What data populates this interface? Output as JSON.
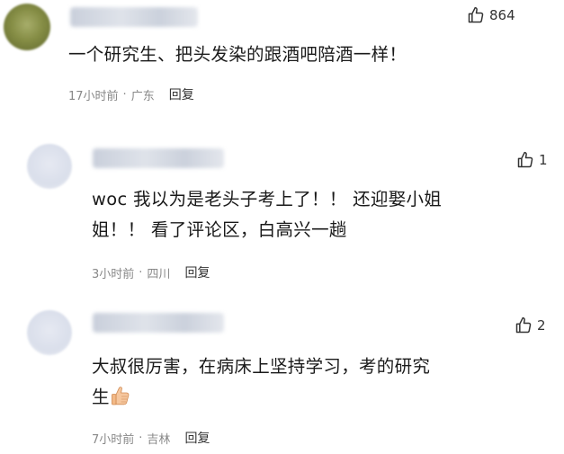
{
  "comments": [
    {
      "likes": "864",
      "text": [
        "一个研究生、把头发染的跟酒吧陪酒一样！"
      ],
      "time": "17小时前",
      "location": "广东",
      "reply": "回复"
    },
    {
      "likes": "1",
      "text": [
        "woc 我以为是老头子考上了！！ 还迎娶小姐",
        "姐！！ 看了评论区，白高兴一趟"
      ],
      "time": "3小时前",
      "location": "四川",
      "reply": "回复"
    },
    {
      "likes": "2",
      "text": [
        "大叔很厉害，在病床上坚持学习，考的研究",
        "生"
      ],
      "emoji": "thumbs-up",
      "time": "7小时前",
      "location": "吉林",
      "reply": "回复"
    }
  ],
  "meta_separator": "·",
  "colors": {
    "avatar_1": "#7f8a3e",
    "avatar_reply": "#dde2ee",
    "username_blur": "#cfd4de"
  },
  "icons": [
    "thumb-up-outline-icon",
    "thumbs-up-emoji"
  ]
}
